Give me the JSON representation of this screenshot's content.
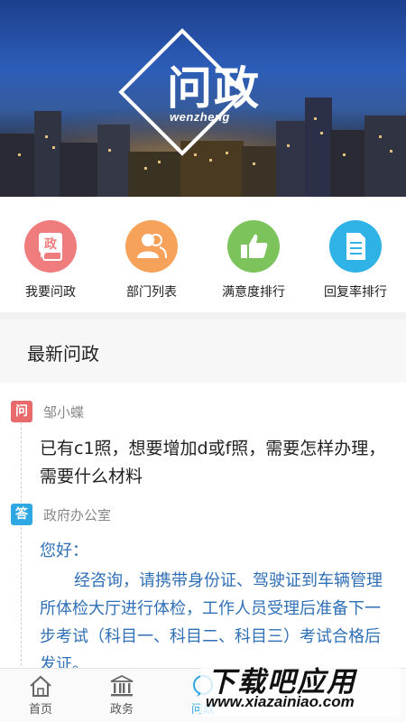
{
  "banner": {
    "logo_cn": "问政",
    "logo_en": "wenzheng"
  },
  "quick_entries": [
    {
      "label": "我要问政",
      "icon": "chat-ask-icon",
      "color": "#f07d7d",
      "glyph": "政"
    },
    {
      "label": "部门列表",
      "icon": "people-icon",
      "color": "#f6a25a"
    },
    {
      "label": "满意度排行",
      "icon": "thumbs-up-icon",
      "color": "#7cc35b"
    },
    {
      "label": "回复率排行",
      "icon": "document-icon",
      "color": "#2fb2e6"
    }
  ],
  "section": {
    "title": "最新问政"
  },
  "post": {
    "question_badge": "问",
    "asker": "邹小蝶",
    "question": "已有c1照，想要增加d或f照，需要怎样办理，需要什么材料",
    "answer_badge": "答",
    "department": "政府办公室",
    "greeting": "您好：",
    "reply": "经咨询，请携带身份证、驾驶证到车辆管理所体检大厅进行体检，工作人员受理后准备下一步考试（科目一、科目二、科目三）考试合格后发证。"
  },
  "tabbar": {
    "tabs": [
      {
        "label": "首页",
        "icon": "home-icon"
      },
      {
        "label": "政务",
        "icon": "government-building-icon"
      },
      {
        "label": "问政",
        "icon": "ask-icon"
      }
    ],
    "active_index": 2
  },
  "watermark": {
    "text": "下载吧应用",
    "url": "www.xiazainiao.com"
  },
  "colors": {
    "accent_blue": "#2fa7e3",
    "question_red": "#e86a6a",
    "reply_blue": "#2f6fb6"
  }
}
